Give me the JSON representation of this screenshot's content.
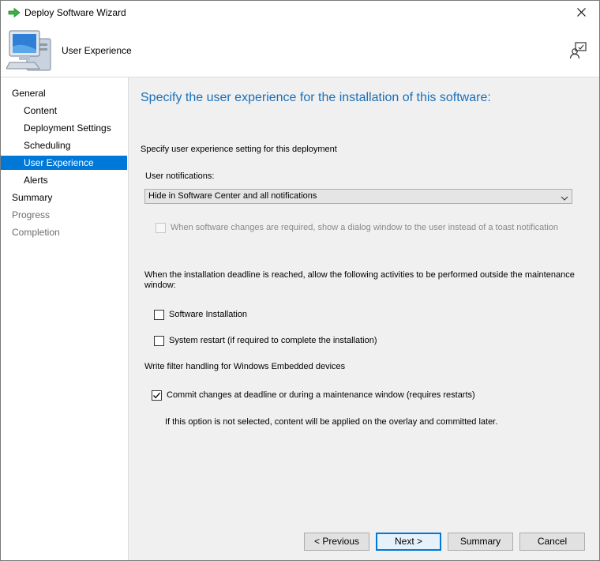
{
  "window": {
    "title": "Deploy Software Wizard"
  },
  "header": {
    "title": "User Experience"
  },
  "sidebar": {
    "items": [
      {
        "label": "General",
        "level": 0,
        "state": "normal"
      },
      {
        "label": "Content",
        "level": 1,
        "state": "normal"
      },
      {
        "label": "Deployment Settings",
        "level": 1,
        "state": "normal"
      },
      {
        "label": "Scheduling",
        "level": 1,
        "state": "normal"
      },
      {
        "label": "User Experience",
        "level": 1,
        "state": "selected"
      },
      {
        "label": "Alerts",
        "level": 1,
        "state": "normal"
      },
      {
        "label": "Summary",
        "level": 0,
        "state": "normal"
      },
      {
        "label": "Progress",
        "level": 0,
        "state": "disabled"
      },
      {
        "label": "Completion",
        "level": 0,
        "state": "disabled"
      }
    ]
  },
  "main": {
    "heading": "Specify the user experience for the installation of this software:",
    "intro": "Specify user experience setting for this deployment",
    "notifications_label": "User notifications:",
    "notifications_value": "Hide in Software Center and all notifications",
    "dialog_option": "When software changes are required, show a dialog window to the user instead of a toast notification",
    "deadline_text_line1": "When the installation deadline is reached, allow the following activities to be performed outside the maintenance",
    "deadline_text_line2": "window:",
    "software_installation": "Software Installation",
    "system_restart": "System restart  (if required to complete the installation)",
    "write_filter_label": "Write filter handling for Windows Embedded devices",
    "commit_changes": "Commit changes at deadline or during a maintenance window (requires restarts)",
    "commit_note": "If this option is not selected, content will be applied on the overlay and committed later."
  },
  "checkboxes": {
    "dialog_option": false,
    "software_installation": false,
    "system_restart": false,
    "commit_changes": true
  },
  "buttons": {
    "previous": "< Previous",
    "next": "Next >",
    "summary": "Summary",
    "cancel": "Cancel"
  },
  "icons": {
    "title": "green-arrow-icon",
    "header": "computer-icon",
    "help": "help-person-icon",
    "close": "close-icon",
    "dropdown": "chevron-down-icon",
    "check": "check-icon"
  },
  "colors": {
    "accent": "#0078d7",
    "heading": "#1a6fb8",
    "arrow_green": "#3cb043"
  }
}
